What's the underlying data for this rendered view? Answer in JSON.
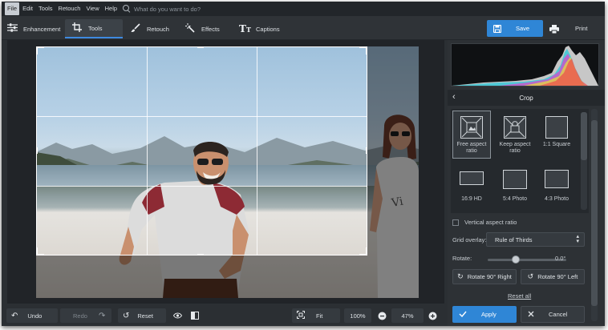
{
  "menubar": {
    "items": [
      "File",
      "Edit",
      "Tools",
      "Retouch",
      "View",
      "Help"
    ],
    "active_item": "File",
    "search_placeholder": "What do you want to do?"
  },
  "toolbar": {
    "tabs": [
      {
        "label": "Enhancement",
        "icon": "sliders-icon"
      },
      {
        "label": "Tools",
        "icon": "crop-icon"
      },
      {
        "label": "Retouch",
        "icon": "brush-icon"
      },
      {
        "label": "Effects",
        "icon": "magic-wand-icon"
      },
      {
        "label": "Captions",
        "icon": "text-icon"
      }
    ],
    "active_tab": "Tools",
    "save_label": "Save",
    "print_label": "Print"
  },
  "bottombar": {
    "undo_label": "Undo",
    "redo_label": "Redo",
    "reset_label": "Reset",
    "fit_label": "Fit",
    "zoom_100_label": "100%",
    "zoom_value": "47%"
  },
  "panel": {
    "title": "Crop",
    "presets": [
      {
        "label": "Free aspect ratio",
        "selected": true
      },
      {
        "label": "Keep aspect ratio",
        "selected": false
      },
      {
        "label": "1:1 Square",
        "selected": false
      },
      {
        "label": "16:9 HD",
        "selected": false
      },
      {
        "label": "5:4 Photo",
        "selected": false
      },
      {
        "label": "4:3 Photo",
        "selected": false
      }
    ],
    "vertical_aspect_label": "Vertical aspect ratio",
    "vertical_aspect_checked": false,
    "grid_overlay_label": "Grid overlay:",
    "grid_overlay_value": "Rule of Thirds",
    "rotate_label": "Rotate:",
    "rotate_value": "0.0°",
    "rotate_right_label": "Rotate 90° Right",
    "rotate_left_label": "Rotate 90° Left",
    "reset_all_label": "Reset all",
    "apply_label": "Apply",
    "cancel_label": "Cancel"
  },
  "colors": {
    "accent": "#2f86d6",
    "background": "#2b2f33",
    "menubar": "#22262a"
  }
}
